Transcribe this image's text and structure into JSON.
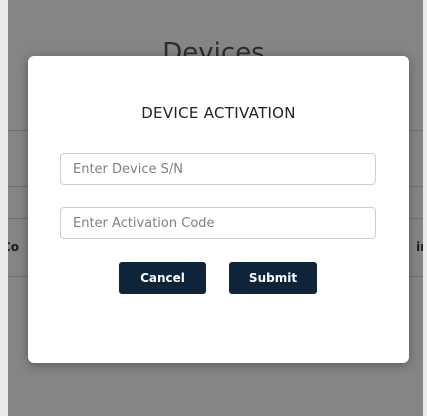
{
  "background_page": {
    "title": "Devices",
    "left_cell_fragment": "t Co",
    "right_cell_fragment": "ino"
  },
  "modal": {
    "title": "DEVICE ACTIVATION",
    "serial_input": {
      "placeholder": "Enter Device S/N",
      "value": ""
    },
    "activation_code_input": {
      "placeholder": "Enter Activation Code",
      "value": ""
    },
    "cancel_label": "Cancel",
    "submit_label": "Submit"
  },
  "colors": {
    "button_bg": "#0e2438",
    "button_text": "#ffffff",
    "backdrop": "rgba(0,0,0,0.48)"
  }
}
